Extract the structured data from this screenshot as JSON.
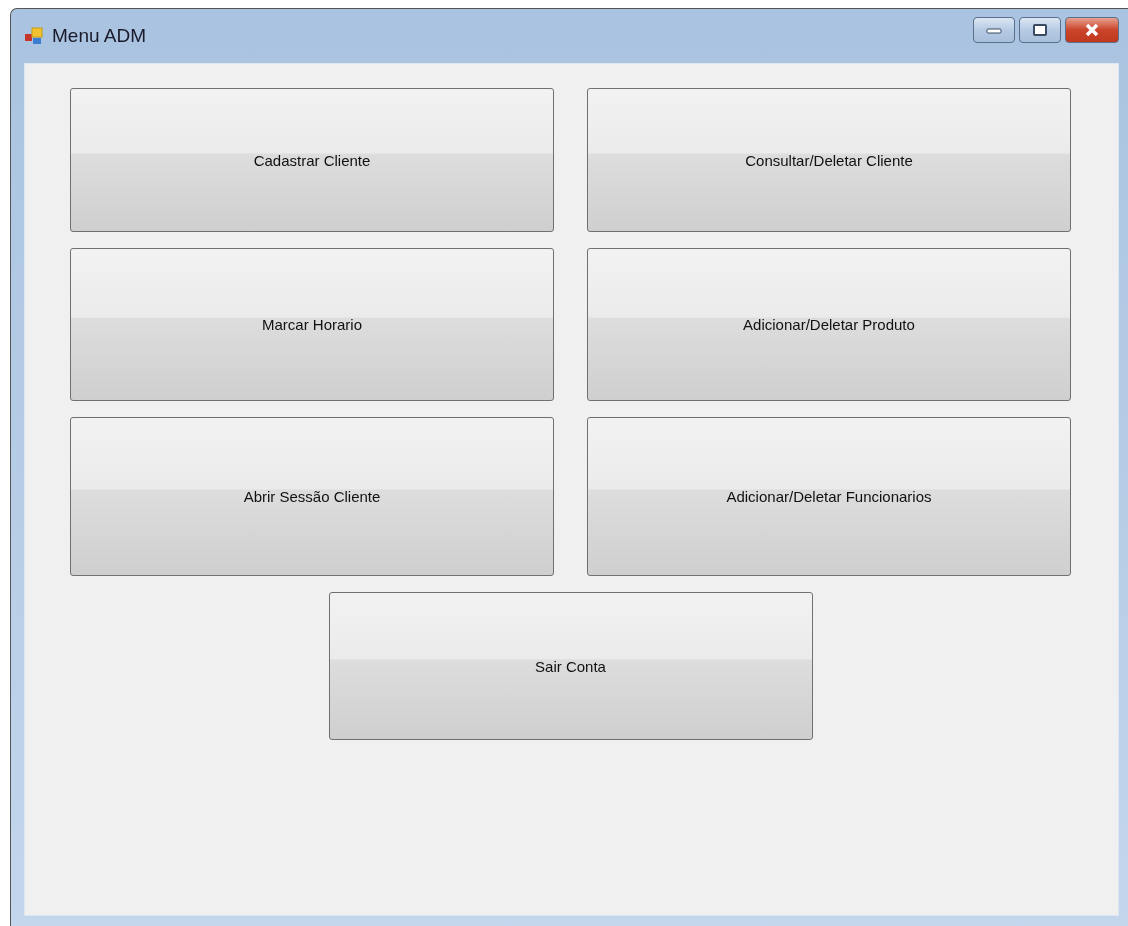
{
  "window": {
    "title": "Menu ADM"
  },
  "button_rows": [
    [
      "Cadastrar Cliente",
      "Consultar/Deletar Cliente"
    ],
    [
      "Marcar Horario",
      "Adicionar/Deletar Produto"
    ],
    [
      "Abrir Sessão Cliente",
      "Adicionar/Deletar Funcionarios"
    ],
    [
      "Sair Conta"
    ]
  ]
}
